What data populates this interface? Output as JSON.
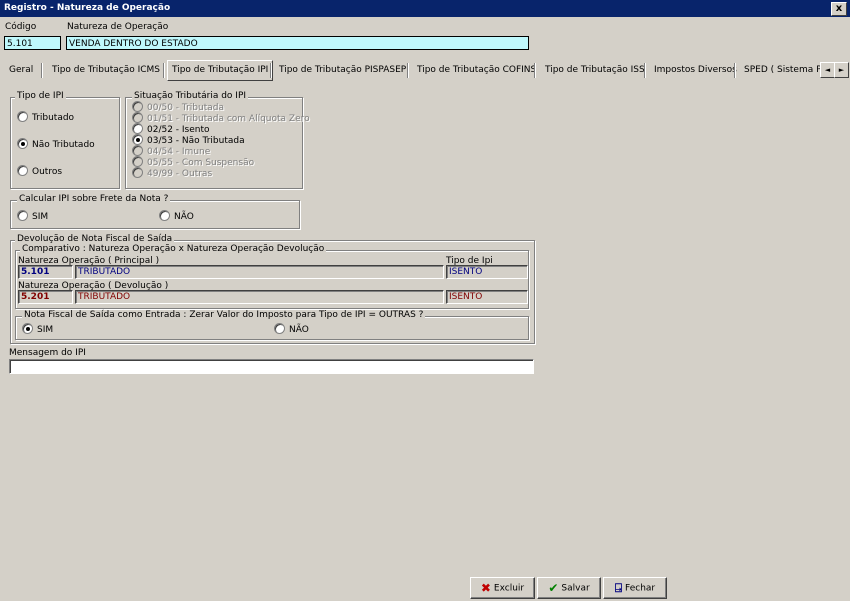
{
  "window": {
    "title": "Registro - Natureza de Operação",
    "close": "x"
  },
  "header": {
    "codigo_label": "Código",
    "codigo_value": "5.101",
    "natureza_label": "Natureza de Operação",
    "natureza_value": "VENDA DENTRO DO ESTADO"
  },
  "tabs": [
    {
      "label": "Geral"
    },
    {
      "label": "Tipo de Tributação  ICMS"
    },
    {
      "label": "Tipo de Tributação IPI"
    },
    {
      "label": "Tipo de Tributação PISPASEP"
    },
    {
      "label": "Tipo de Tributação COFINS"
    },
    {
      "label": "Tipo de Tributação ISS"
    },
    {
      "label": "Impostos Diversos"
    },
    {
      "label": "SPED ( Sistema Pú"
    }
  ],
  "tab_scroll": {
    "left": "◄",
    "right": "►"
  },
  "tipo_ipi": {
    "title": "Tipo de IPI",
    "options": [
      {
        "label": "Tributado",
        "checked": false
      },
      {
        "label": "Não Tributado",
        "checked": true
      },
      {
        "label": "Outros",
        "checked": false
      }
    ]
  },
  "situacao": {
    "title": "Situação Tributária do IPI",
    "options": [
      {
        "label": "00/50 - Tributada",
        "enabled": false,
        "checked": false
      },
      {
        "label": "01/51 - Tributada com Alíquota Zero",
        "enabled": false,
        "checked": false
      },
      {
        "label": "02/52 - Isento",
        "enabled": true,
        "checked": false
      },
      {
        "label": "03/53 - Não Tributada",
        "enabled": true,
        "checked": true
      },
      {
        "label": "04/54 - Imune",
        "enabled": false,
        "checked": false
      },
      {
        "label": "05/55 - Com Suspensão",
        "enabled": false,
        "checked": false
      },
      {
        "label": "49/99 - Outras",
        "enabled": false,
        "checked": false
      }
    ]
  },
  "frete": {
    "title": "Calcular IPI sobre Frete da Nota ?",
    "sim": "SIM",
    "nao": "NÃO"
  },
  "devolucao": {
    "title": "Devolução de Nota Fiscal de Saída",
    "comparativo_title": "Comparativo : Natureza Operação x Natureza Operação Devolução",
    "principal_label": "Natureza Operação ( Principal )",
    "tipo_ipi_label": "Tipo de Ipi",
    "principal_code": "5.101",
    "principal_desc": "TRIBUTADO",
    "principal_tipo": "ISENTO",
    "devolucao_label": "Natureza Operação ( Devolução )",
    "devolucao_code": "5.201",
    "devolucao_desc": "TRIBUTADO",
    "devolucao_tipo": "ISENTO",
    "zerar_title": "Nota Fiscal de Saída como Entrada : Zerar Valor do Imposto para Tipo de IPI = OUTRAS ?",
    "zerar_sim": "SIM",
    "zerar_nao": "NÃO"
  },
  "mensagem": {
    "label": "Mensagem do IPI",
    "value": ""
  },
  "buttons": {
    "excluir": "Excluir",
    "salvar": "Salvar",
    "fechar": "Fechar"
  },
  "colors": {
    "blue_text": "#000080",
    "red_text": "#800000",
    "title_bar": "#08246b",
    "cyan_field": "#bff8fc"
  }
}
